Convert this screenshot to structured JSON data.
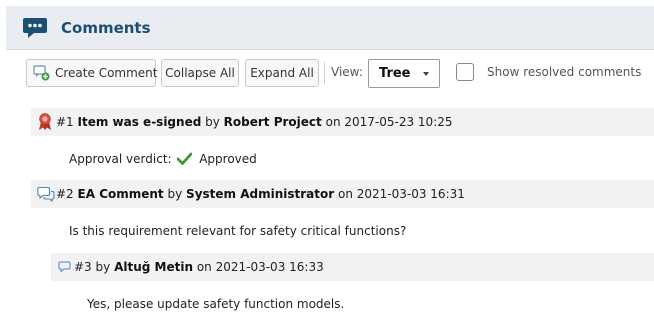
{
  "header": {
    "title": "Comments",
    "icon": "speech-bubble-icon",
    "accent": "#1c4f74"
  },
  "toolbar": {
    "create_label": "Create Comment",
    "collapse_label": "Collapse All",
    "expand_label": "Expand All",
    "view_label": "View:",
    "view_value": "Tree",
    "show_resolved_label": "Show resolved comments",
    "show_resolved_checked": false
  },
  "comments": [
    {
      "num": "#1",
      "title": "Item was e-signed",
      "by_word": "by",
      "author": "Robert Project",
      "on_date": "on 2017-05-23 10:25",
      "icon": "ribbon-icon",
      "verdict_label": "Approval verdict:",
      "verdict_value": "Approved"
    },
    {
      "num": "#2",
      "title": "EA Comment",
      "by_word": "by",
      "author": "System Administrator",
      "on_date": "on 2021-03-03 16:31",
      "icon": "comments-icon",
      "body": "Is this requirement relevant for safety critical functions?"
    },
    {
      "num": "#3",
      "by_word": "by",
      "author": "Altuğ Metin",
      "on_date": "on 2021-03-03 16:33",
      "icon": "comment-icon",
      "body": "Yes, please update safety function models."
    }
  ]
}
